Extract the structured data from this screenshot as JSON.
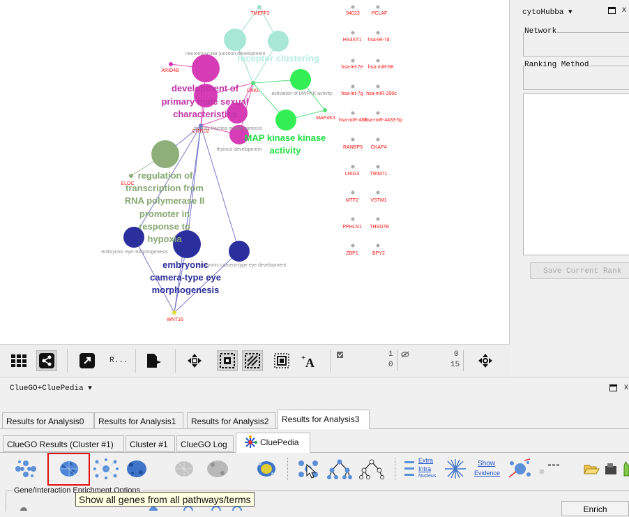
{
  "network": {
    "nodes_red": [
      "TMEFF2",
      "94023",
      "PCLAF",
      "HS3ST1",
      "hsa-let-7d",
      "hsa-let-7e",
      "hsa-miR-98",
      "hsa-let-7g",
      "hsa-miR-200c",
      "MAP4K3",
      "hsa-miR-488",
      "hsa-miR-4433-5p",
      "RANBP9",
      "CKAP4",
      "LRIG3",
      "TRIM71",
      "MTF2",
      "VSTM1",
      "PPHLN1",
      "THSD7B",
      "ZBP1",
      "BPY2",
      "ARID4B",
      "CRKL",
      "ELOC",
      "WNT16",
      "CITED2"
    ],
    "labels_small": [
      "neuromuscular junction development",
      "activation of MAPKK activity",
      "thymus development",
      "thymus trachea morphogenesis",
      "embryonic eye morphogenesis",
      "embryonic camera-type eye development"
    ],
    "labels_big": {
      "receptor_clustering": "receptor clustering",
      "dev_male_1": "development of",
      "dev_male_2": "primary male sexual",
      "dev_male_3": "characteristics",
      "mapkkk_1": "MAP kinase kinase",
      "mapkkk_2": "activity",
      "reg_1": "regulation of",
      "reg_2": "transcription from",
      "reg_3": "RNA polymerase II",
      "reg_4": "promoter in",
      "reg_5": "response to",
      "reg_6": "hypoxia",
      "eye_1": "embryonic",
      "eye_2": "camera-type eye",
      "eye_3": "morphogenesis"
    }
  },
  "toolbar": {
    "r_label": "R...",
    "count1_top": "1",
    "count1_bottom": "0",
    "count2_top": "0",
    "count2_bottom": "15"
  },
  "cytohubba": {
    "title": "cytoHubba ▾",
    "network_label": "Network",
    "ranking_label": "Ranking Method",
    "save_button": "Save Current Rank"
  },
  "cluepanel": {
    "title": "ClueGO+CluePedia ▾",
    "tabs_top": [
      "Results for Analysis0",
      "Results for Analysis1",
      "Results for Analysis2",
      "Results for Analysis3"
    ],
    "tabs_sub": [
      "ClueGO Results (Cluster #1)",
      "Cluster #1",
      "ClueGO Log",
      "CluePedia"
    ],
    "extra": "Extra",
    "intra": "Intra",
    "nucleus": "Nucleus",
    "show": "Show",
    "evidence": "Evidence",
    "tooltip": "Show all genes from all pathways/terms",
    "options_label": "Gene/Interaction Enrichment Options",
    "enrich_button": "Enrich"
  },
  "colors": {
    "teal": "#a8e6d6",
    "magenta": "#d63cb5",
    "green": "#33ee55",
    "olive": "#8faf7a",
    "navy": "#2b2f9e",
    "red": "#ff1111"
  }
}
